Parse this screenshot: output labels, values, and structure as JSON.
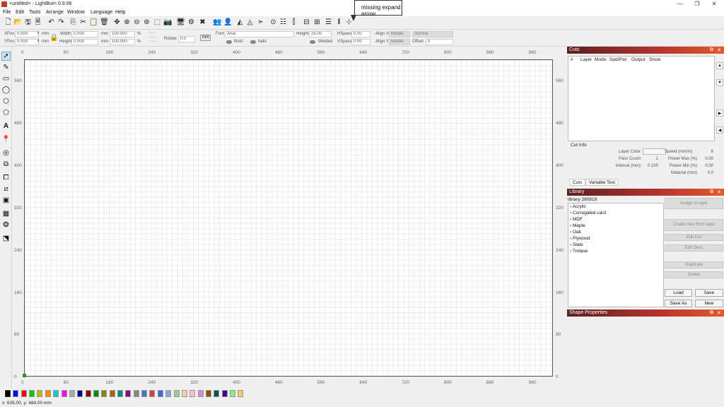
{
  "window": {
    "title": "<untitled> - LightBurn 0.9.06",
    "minimize": "—",
    "maximize": "❐",
    "close": "✕"
  },
  "menubar": [
    "File",
    "Edit",
    "Tools",
    "Arrange",
    "Window",
    "Language",
    "Help"
  ],
  "callout": {
    "text": "missing expand arrow"
  },
  "props": {
    "xpos_label": "XPos",
    "xpos_value": "0.000",
    "ypos_label": "YPos",
    "ypos_value": "0.000",
    "unit_mm": "mm",
    "width_label": "Width",
    "width_value": "0.000",
    "height_label": "Height",
    "height_value": "0.000",
    "scale_w": "100.000",
    "scale_h": "100.000",
    "pct": "%",
    "rotate_label": "Rotate",
    "rotate_value": "0.0",
    "mm_button": "mm",
    "font_label": "Font",
    "font_value": "Arial",
    "font_height_label": "Height",
    "font_height_value": "25.00",
    "bold_label": "Bold",
    "italic_label": "Italic",
    "welded_label": "Welded",
    "hspace_label": "HSpace",
    "hspace_value": "0.00",
    "vspace_label": "VSpace",
    "vspace_value": "0.00",
    "alignx_label": "Align X",
    "alignx_value": "Middle",
    "aligny_label": "Align Y",
    "aligny_value": "Middle",
    "mode_value": "Normal",
    "offset_label": "Offset",
    "offset_value": "0"
  },
  "ruler": {
    "x_ticks": [
      "0",
      "80",
      "160",
      "240",
      "320",
      "400",
      "480",
      "560",
      "640",
      "720",
      "800",
      "880",
      "960"
    ],
    "y_ticks": [
      "560",
      "480",
      "400",
      "320",
      "240",
      "160",
      "80",
      "0"
    ]
  },
  "palette": {
    "colors": [
      "#000000",
      "#0000ff",
      "#ff0000",
      "#00cc00",
      "#bbbb00",
      "#ff8800",
      "#00cccc",
      "#ff00ff",
      "#aaaaaa",
      "#000088",
      "#880000",
      "#008800",
      "#888800",
      "#aa6600",
      "#008888",
      "#880088",
      "#888888",
      "#4477cc",
      "#cc4444",
      "#4466dd",
      "#88aacc",
      "#99cc99",
      "#ffcc99",
      "#ffbbdd",
      "#dd88cc",
      "#885500",
      "#005555",
      "#440088",
      "#88ee88",
      "#eecc66"
    ]
  },
  "status": {
    "coords": "x: 635.00, y: 484.00 mm"
  },
  "cuts": {
    "title": "Cuts",
    "columns": [
      "#",
      "Layer",
      "Mode",
      "Spd/Pwr",
      "Output",
      "Show"
    ],
    "cut_info_title": "Cut Info",
    "layer_color_label": "Layer Color",
    "pass_count_label": "Pass Count",
    "pass_count_value": "1",
    "interval_label": "Interval (mm)",
    "interval_value": "0.100",
    "speed_label": "Speed (mm/m)",
    "speed_value": "6",
    "power_max_label": "Power Max (%)",
    "power_max_value": "0.00",
    "power_min_label": "Power Min (%)",
    "power_min_value": "0.00",
    "material_label": "Material (mm)",
    "material_value": "0.0",
    "tabs": [
      "Cuts",
      "Variable Text"
    ]
  },
  "library": {
    "title": "Library",
    "name": "library 280819",
    "items": [
      "Acrylic",
      "Corrugated card",
      "MDF",
      "Maple",
      "Oak",
      "Plywood",
      "Slate",
      "Trolase"
    ],
    "assign_label": "Assign to layer",
    "create_label": "Create new from layer",
    "edit_cut_label": "Edit Cut",
    "edit_desc_label": "Edit Desc",
    "duplicate_label": "Duplicate",
    "delete_label": "Delete",
    "load_label": "Load",
    "save_label": "Save",
    "save_as_label": "Save As",
    "new_label": "New"
  },
  "shape_props": {
    "title": "Shape Properties"
  }
}
